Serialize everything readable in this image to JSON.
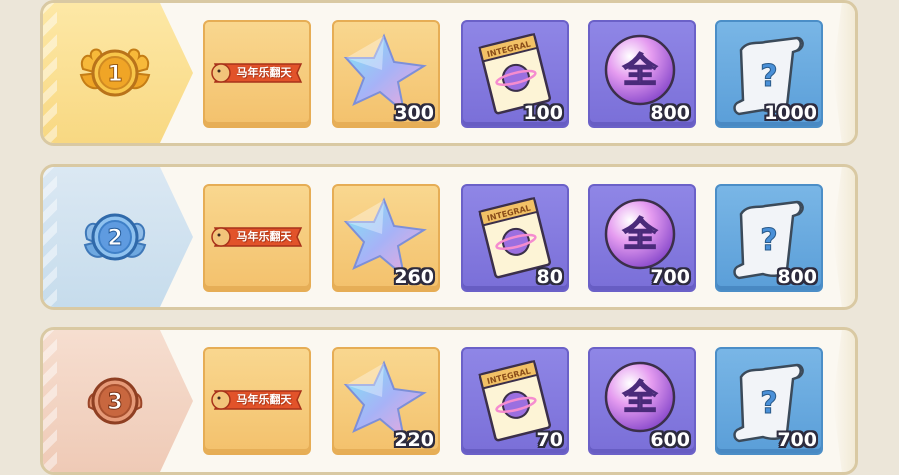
{
  "rows": [
    {
      "rank": "1",
      "banner_text": "马年乐翻天",
      "counts": {
        "star": "300",
        "ticket": "100",
        "orb": "800",
        "scroll": "1000"
      }
    },
    {
      "rank": "2",
      "banner_text": "马年乐翻天",
      "counts": {
        "star": "260",
        "ticket": "80",
        "orb": "700",
        "scroll": "800"
      }
    },
    {
      "rank": "3",
      "banner_text": "马年乐翻天",
      "counts": {
        "star": "220",
        "ticket": "70",
        "orb": "600",
        "scroll": "700"
      }
    }
  ],
  "labels": {
    "ticket_word": "INTEGRAL",
    "orb_char": "全",
    "scroll_char": "?"
  },
  "colors": {
    "gold_medal": "#f0a526",
    "silver_medal": "#5f9be0",
    "bronze_medal": "#c8673f",
    "item_gold": "#f3c16c",
    "item_purple": "#7a6fd8",
    "item_blue": "#5a9ed8"
  },
  "icons": {
    "medal": "rank-medal-icon",
    "banner": "event-banner-icon",
    "star": "crystal-star-icon",
    "ticket": "integral-ticket-icon",
    "orb": "full-orb-icon",
    "scroll": "mystery-scroll-icon"
  }
}
